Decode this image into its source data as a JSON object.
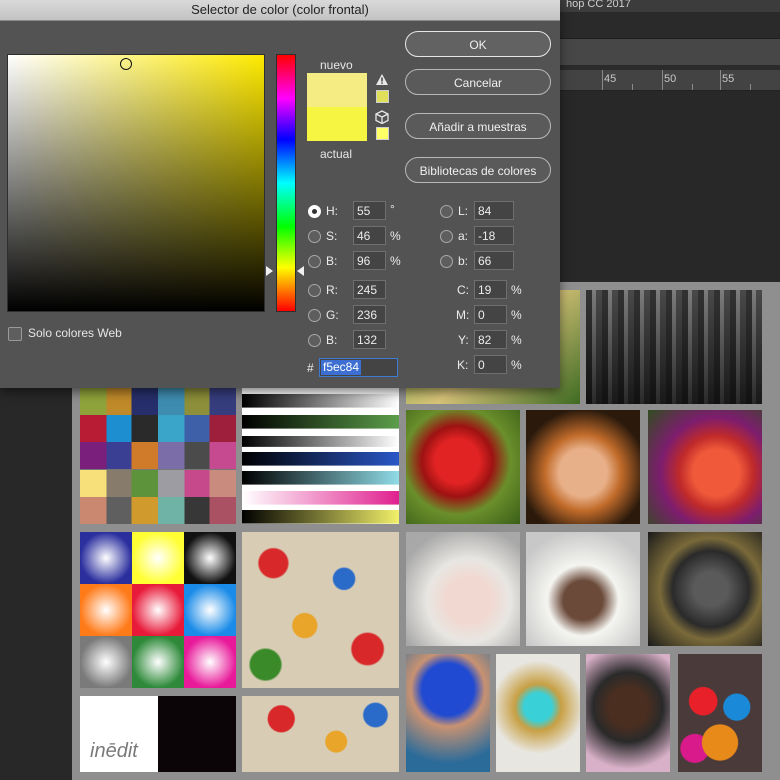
{
  "dialog": {
    "title": "Selector de color (color frontal)",
    "label_new": "nuevo",
    "label_current": "actual",
    "web_only_label": "Solo colores Web",
    "new_color": "#f5ec84",
    "current_color": "#f5f542",
    "gamut_warning_color": "#e0e05a",
    "web_safe_color": "#ffff66",
    "hue_base_color": "#ffea00",
    "buttons": {
      "ok": "OK",
      "cancel": "Cancelar",
      "add_swatches": "Añadir a muestras",
      "libraries": "Bibliotecas de colores"
    },
    "hsb": [
      {
        "label": "H:",
        "value": "55",
        "unit": "°",
        "selected": true
      },
      {
        "label": "S:",
        "value": "46",
        "unit": "%",
        "selected": false
      },
      {
        "label": "B:",
        "value": "96",
        "unit": "%",
        "selected": false
      }
    ],
    "rgb": [
      {
        "label": "R:",
        "value": "245"
      },
      {
        "label": "G:",
        "value": "236"
      },
      {
        "label": "B:",
        "value": "132"
      }
    ],
    "lab": [
      {
        "label": "L:",
        "value": "84"
      },
      {
        "label": "a:",
        "value": "-18"
      },
      {
        "label": "b:",
        "value": "66"
      }
    ],
    "cmyk": [
      {
        "label": "C:",
        "value": "19",
        "unit": "%"
      },
      {
        "label": "M:",
        "value": "0",
        "unit": "%"
      },
      {
        "label": "Y:",
        "value": "82",
        "unit": "%"
      },
      {
        "label": "K:",
        "value": "0",
        "unit": "%"
      }
    ],
    "hex_prefix": "#",
    "hex_value": "f5ec84"
  },
  "background": {
    "app_title_fragment": "hop CC 2017",
    "ruler_numbers": [
      "45",
      "50",
      "55"
    ],
    "logo_text": "inēdit"
  },
  "icons": {
    "warning": "warning-triangle-icon",
    "cube": "web-cube-icon"
  }
}
